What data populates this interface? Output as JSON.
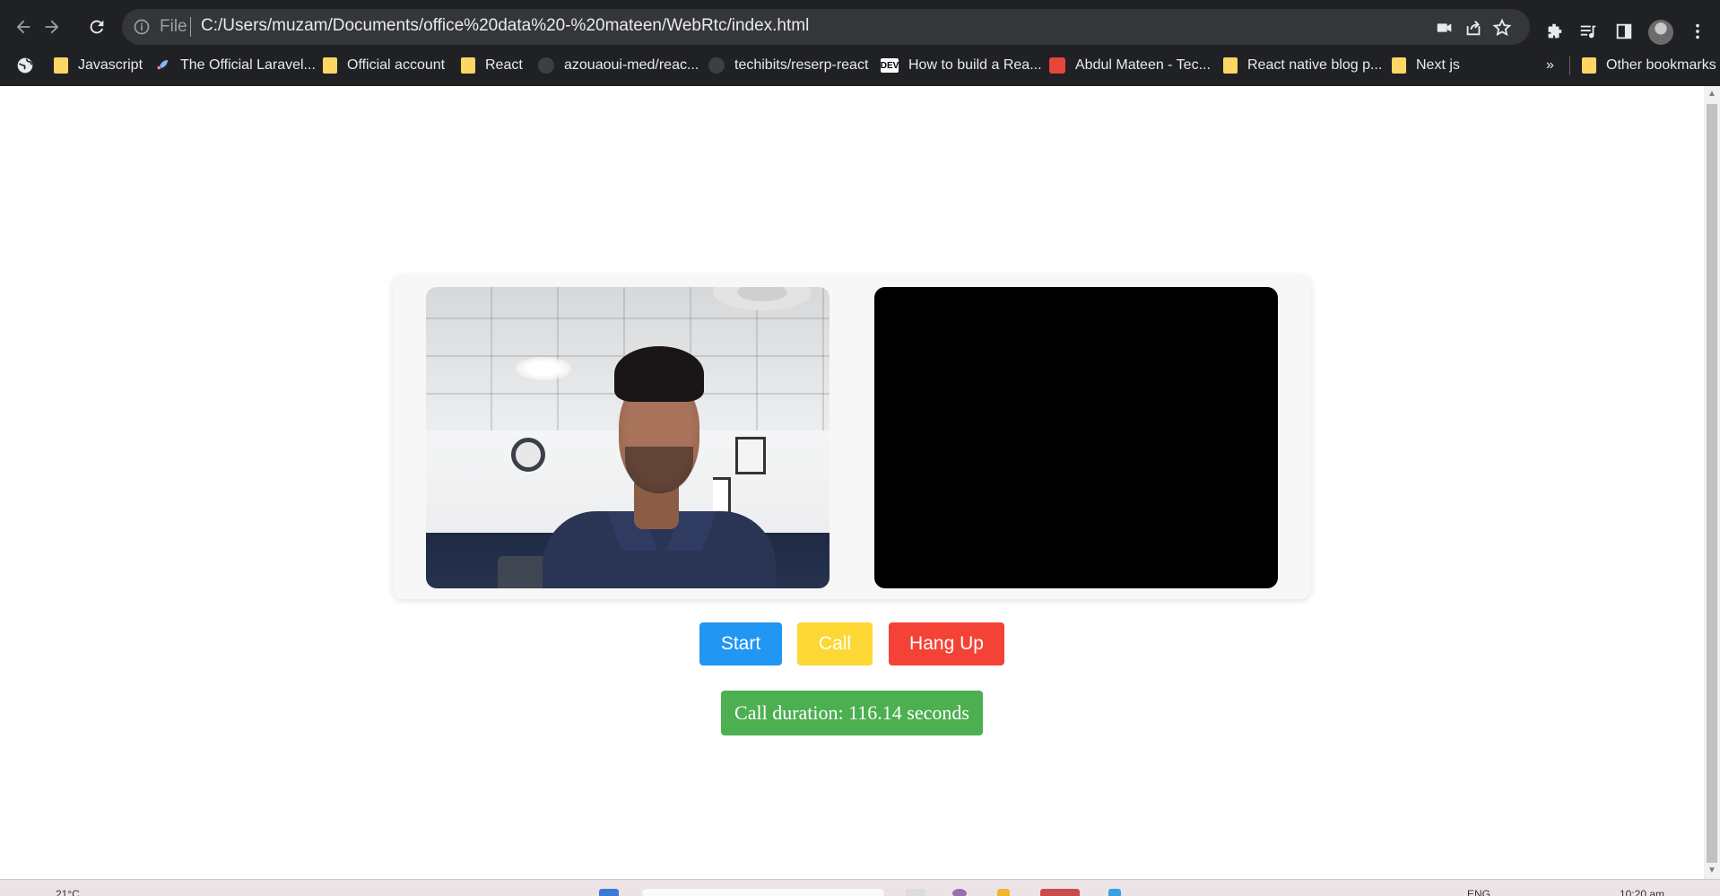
{
  "browser": {
    "scheme_label": "File",
    "url": "C:/Users/muzam/Documents/office%20data%20-%20mateen/WebRtc/index.html",
    "bookmarks": [
      {
        "label": "Javascript",
        "icon": "folder-icon"
      },
      {
        "label": "The Official Laravel...",
        "icon": "rocket-icon"
      },
      {
        "label": "Official account",
        "icon": "folder-icon"
      },
      {
        "label": "React",
        "icon": "folder-icon"
      },
      {
        "label": "azouaoui-med/reac...",
        "icon": "github-icon"
      },
      {
        "label": "techibits/reserp-react",
        "icon": "github-icon"
      },
      {
        "label": "How to build a Rea...",
        "icon": "dev-icon"
      },
      {
        "label": "Abdul Mateen - Tec...",
        "icon": "hashnode-icon"
      },
      {
        "label": "React native blog p...",
        "icon": "folder-icon"
      },
      {
        "label": "Next js",
        "icon": "folder-icon"
      }
    ],
    "overflow_label": "»",
    "other_bookmarks": "Other bookmarks",
    "dev_badge": "DEV"
  },
  "page": {
    "buttons": {
      "start": "Start",
      "call": "Call",
      "hangup": "Hang Up"
    },
    "duration_text": "Call duration: 116.14 seconds"
  },
  "taskbar": {
    "weather": "21°C",
    "language": "ENG",
    "time": "10:20 am"
  },
  "colors": {
    "start": "#2196f3",
    "call": "#fdd835",
    "hangup": "#f44336",
    "duration": "#4caf50"
  }
}
